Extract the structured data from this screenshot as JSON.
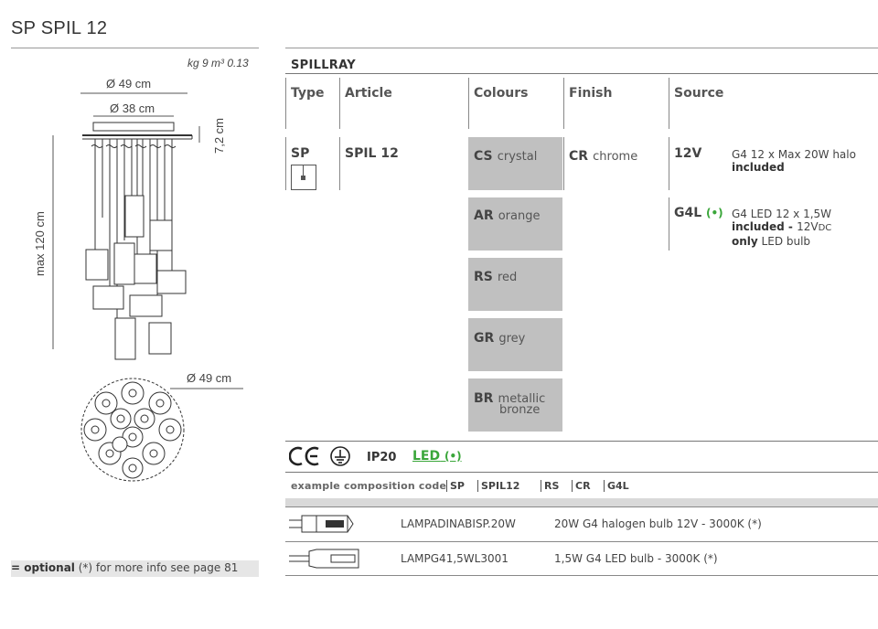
{
  "title": "SP SPIL 12",
  "weight": "kg 9 m³ 0.13",
  "dimensions": {
    "outer_diameter": "Ø 49 cm",
    "canopy_diameter": "Ø 38 cm",
    "canopy_height": "7,2 cm",
    "max_height": "max 120 cm",
    "bottom_diameter": "Ø 49 cm"
  },
  "table": {
    "family": "SPILLRAY",
    "headers": {
      "type": "Type",
      "article": "Article",
      "colours": "Colours",
      "finish": "Finish",
      "source": "Source"
    },
    "type_code": "SP",
    "article": "SPIL 12",
    "colours": [
      {
        "code": "CS",
        "name": "crystal"
      },
      {
        "code": "AR",
        "name": "orange"
      },
      {
        "code": "RS",
        "name": "red"
      },
      {
        "code": "GR",
        "name": "grey"
      },
      {
        "code": "BR",
        "name": "metallic",
        "name2": "bronze"
      }
    ],
    "finish": {
      "code": "CR",
      "name": "chrome"
    },
    "sources": [
      {
        "code": "12V",
        "line1": "G4 12 x Max 20W halo",
        "line2": "included"
      },
      {
        "code": "G4L",
        "marker": "(•)",
        "line1": "G4 LED 12 x 1,5W",
        "line2a": "included - ",
        "line2b": "12V",
        "line2c": "DC",
        "line3a": "only",
        "line3b": " LED bulb"
      }
    ]
  },
  "certifications": {
    "ip": "IP20",
    "led": "LED",
    "led_marker": "(•)"
  },
  "example": {
    "label": "example composition code",
    "codes": [
      "SP",
      "SPIL12",
      "RS",
      "CR",
      "G4L"
    ]
  },
  "bulbs": [
    {
      "code": "LAMPADINABISP.20W",
      "desc": "20W G4 halogen bulb 12V - 3000K (*)"
    },
    {
      "code": "LAMPG41,5WL3001",
      "desc": "1,5W G4 LED bulb - 3000K (*)"
    }
  ],
  "footer": {
    "optional": "= optional",
    "note": " (*) for more info see page 81"
  }
}
